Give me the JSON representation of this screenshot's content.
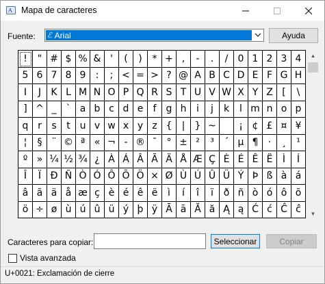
{
  "window": {
    "title": "Mapa de caracteres",
    "icon": "charmap-app-icon"
  },
  "controls": {
    "minimize": "—",
    "maximize": "☐",
    "close": "✕"
  },
  "font_picker": {
    "label": "Fuente:",
    "selected": "Arial",
    "icon": "opentype-font-icon",
    "arrow": "⌄"
  },
  "help_button": "Ayuda",
  "char_rows": [
    [
      "!",
      "\"",
      "#",
      "$",
      "%",
      "&",
      "'",
      "(",
      ")",
      "*",
      "+",
      ",",
      "-",
      ".",
      "/",
      "0",
      "1",
      "2",
      "3",
      "4"
    ],
    [
      "5",
      "6",
      "7",
      "8",
      "9",
      ":",
      ";",
      "<",
      "=",
      ">",
      "?",
      "@",
      "A",
      "B",
      "C",
      "D",
      "E",
      "F",
      "G",
      "H"
    ],
    [
      "I",
      "J",
      "K",
      "L",
      "M",
      "N",
      "O",
      "P",
      "Q",
      "R",
      "S",
      "T",
      "U",
      "V",
      "W",
      "X",
      "Y",
      "Z",
      "[",
      "\\"
    ],
    [
      "]",
      "^",
      "_",
      "`",
      "a",
      "b",
      "c",
      "d",
      "e",
      "f",
      "g",
      "h",
      "i",
      "j",
      "k",
      "l",
      "m",
      "n",
      "o",
      "p"
    ],
    [
      "q",
      "r",
      "s",
      "t",
      "u",
      "v",
      "w",
      "x",
      "y",
      "z",
      "{",
      "|",
      "}",
      "~",
      " ",
      "¡",
      "¢",
      "£",
      "¤",
      "¥"
    ],
    [
      "¦",
      "§",
      "¨",
      "©",
      "ª",
      "«",
      "¬",
      "-",
      "®",
      "¯",
      "°",
      "±",
      "²",
      "³",
      "´",
      "µ",
      "¶",
      "·",
      "¸",
      "¹"
    ],
    [
      "º",
      "»",
      "¼",
      "½",
      "¾",
      "¿",
      "À",
      "Á",
      "Â",
      "Ã",
      "Ä",
      "Å",
      "Æ",
      "Ç",
      "È",
      "É",
      "Ê",
      "Ë",
      "Ì",
      "Í"
    ],
    [
      "Î",
      "Ï",
      "Ð",
      "Ñ",
      "Ò",
      "Ó",
      "Ô",
      "Õ",
      "Ö",
      "×",
      "Ø",
      "Ù",
      "Ú",
      "Û",
      "Ü",
      "Ý",
      "Þ",
      "ß",
      "à",
      "á"
    ],
    [
      "â",
      "ã",
      "ä",
      "å",
      "æ",
      "ç",
      "è",
      "é",
      "ê",
      "ë",
      "ì",
      "í",
      "î",
      "ï",
      "ð",
      "ñ",
      "ò",
      "ó",
      "ô",
      "õ"
    ],
    [
      "ö",
      "÷",
      "ø",
      "ù",
      "ú",
      "û",
      "ü",
      "ý",
      "þ",
      "ÿ",
      "Ā",
      "ā",
      "Ă",
      "ă",
      "Ą",
      "ą",
      "Ć",
      "ć",
      "Ĉ",
      "ĉ"
    ]
  ],
  "selected_char_index": 0,
  "copy": {
    "label": "Caracteres para copiar:",
    "value": "",
    "select_button": "Seleccionar",
    "copy_button": "Copiar"
  },
  "advanced_view": {
    "label": "Vista avanzada",
    "checked": false
  },
  "status": "U+0021: Exclamación de cierre",
  "colors": {
    "selection": "#0078d7",
    "window_bg": "#f0f0f0"
  }
}
